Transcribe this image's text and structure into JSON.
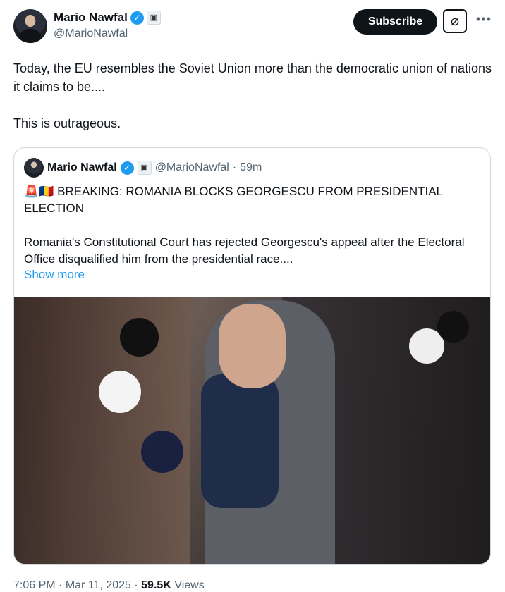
{
  "author": {
    "name": "Mario Nawfal",
    "handle": "@MarioNawfal",
    "verified_icon": "verified-badge-icon",
    "affiliation_icon": "affiliate-badge-icon"
  },
  "actions": {
    "subscribe_label": "Subscribe",
    "grok_icon": "grok-icon",
    "more_icon": "more-icon"
  },
  "tweet": {
    "line1": "Today, the EU resembles the Soviet Union more than the democratic union of nations it claims to be....",
    "line2": "This is outrageous."
  },
  "quote": {
    "name": "Mario Nawfal",
    "handle": "@MarioNawfal",
    "separator": "·",
    "time": "59m",
    "emoji_siren": "🚨",
    "emoji_flag": "🇷🇴",
    "headline": "BREAKING: ROMANIA BLOCKS GEORGESCU FROM PRESIDENTIAL ELECTION",
    "body": "Romania's Constitutional Court has rejected Georgescu's appeal after the Electoral Office disqualified him from the presidential race....",
    "show_more": "Show more"
  },
  "footer": {
    "time": "7:06 PM",
    "sep1": "·",
    "date": "Mar 11, 2025",
    "sep2": "·",
    "views_count": "59.5K",
    "views_label": "Views"
  },
  "colors": {
    "accent": "#1d9bf0",
    "text": "#0f1419",
    "muted": "#536471",
    "border": "#cfd9de"
  }
}
